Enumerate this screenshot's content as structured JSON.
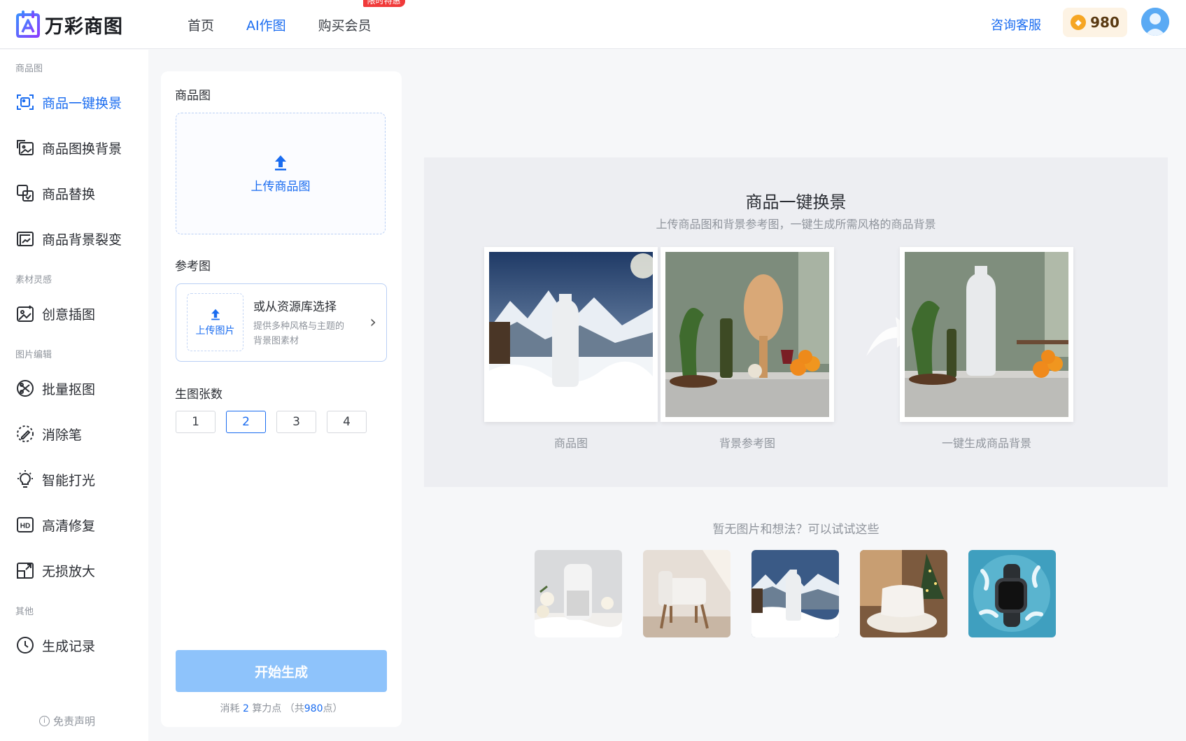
{
  "brand": {
    "name": "万彩商图"
  },
  "nav": {
    "items": [
      {
        "label": "首页"
      },
      {
        "label": "AI作图"
      },
      {
        "label": "购买会员"
      }
    ],
    "badge": "限时特惠",
    "consult": "咨询客服",
    "coins": "980"
  },
  "sidebar": {
    "sections": [
      {
        "title": "商品图"
      },
      {
        "title": "素材灵感"
      },
      {
        "title": "图片编辑"
      },
      {
        "title": "其他"
      }
    ],
    "items": [
      {
        "label": "商品一键换景"
      },
      {
        "label": "商品图换背景"
      },
      {
        "label": "商品替换"
      },
      {
        "label": "商品背景裂变"
      },
      {
        "label": "创意插图"
      },
      {
        "label": "批量抠图"
      },
      {
        "label": "消除笔"
      },
      {
        "label": "智能打光"
      },
      {
        "label": "高清修复"
      },
      {
        "label": "无损放大"
      },
      {
        "label": "生成记录"
      }
    ],
    "disclaimer": "免责声明"
  },
  "panel": {
    "product_label": "商品图",
    "upload_product": "上传商品图",
    "reference_label": "参考图",
    "upload_image": "上传图片",
    "library_title": "或从资源库选择",
    "library_desc": "提供多种风格与主题的背景图素材",
    "count_label": "生图张数",
    "counts": [
      "1",
      "2",
      "3",
      "4"
    ],
    "selected_count": "2",
    "generate": "开始生成",
    "cost": {
      "prefix": "消耗",
      "amount": "2",
      "unit": "算力点",
      "total_prefix": "（共",
      "total": "980",
      "total_suffix": "点）"
    }
  },
  "demo": {
    "title": "商品一键换景",
    "subtitle": "上传商品图和背景参考图，一键生成所需风格的商品背景",
    "captions": [
      "商品图",
      "背景参考图",
      "一键生成商品背景"
    ]
  },
  "try": {
    "title": "暂无图片和想法？可以试试这些"
  },
  "colors": {
    "accent": "#1a6cf0",
    "badge": "#f03a3a",
    "generate_disabled": "#8ec3fb"
  }
}
